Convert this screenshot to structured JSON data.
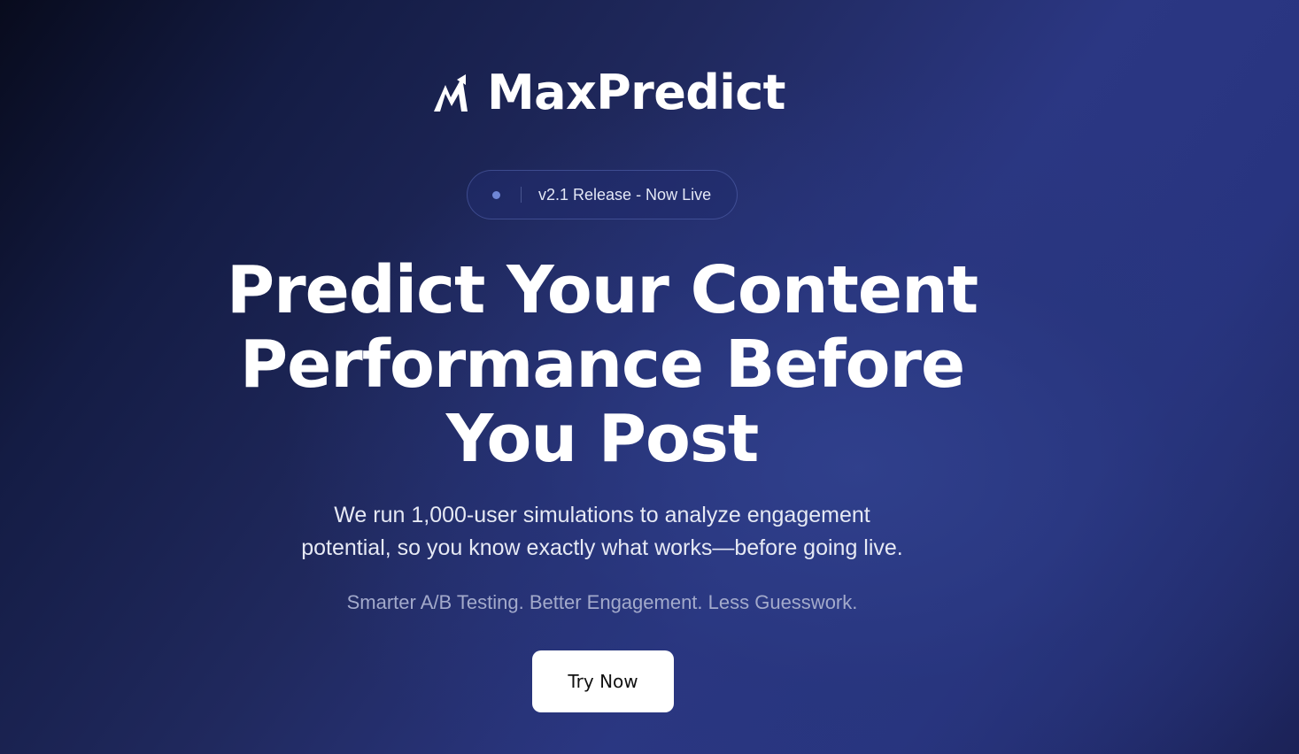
{
  "brand": {
    "logo_icon": "mountain-arrow-icon",
    "name": "MaxPredict"
  },
  "release_badge": {
    "dot_color": "#6f86d6",
    "text": "v2.1 Release - Now Live"
  },
  "hero": {
    "headline_lines": [
      "Predict Your Content",
      "Performance Before",
      "You Post"
    ],
    "description_lines": [
      "We run 1,000-user simulations to analyze engagement",
      "potential, so you know exactly what works—before going live."
    ],
    "tagline": "Smarter A/B Testing. Better Engagement. Less Guesswork.",
    "cta_label": "Try Now"
  },
  "colors": {
    "background_dark": "#080b1d",
    "background_accent": "#2b3783",
    "button_bg": "#ffffff",
    "text_primary": "#ffffff",
    "text_muted": "#a3aacb"
  }
}
